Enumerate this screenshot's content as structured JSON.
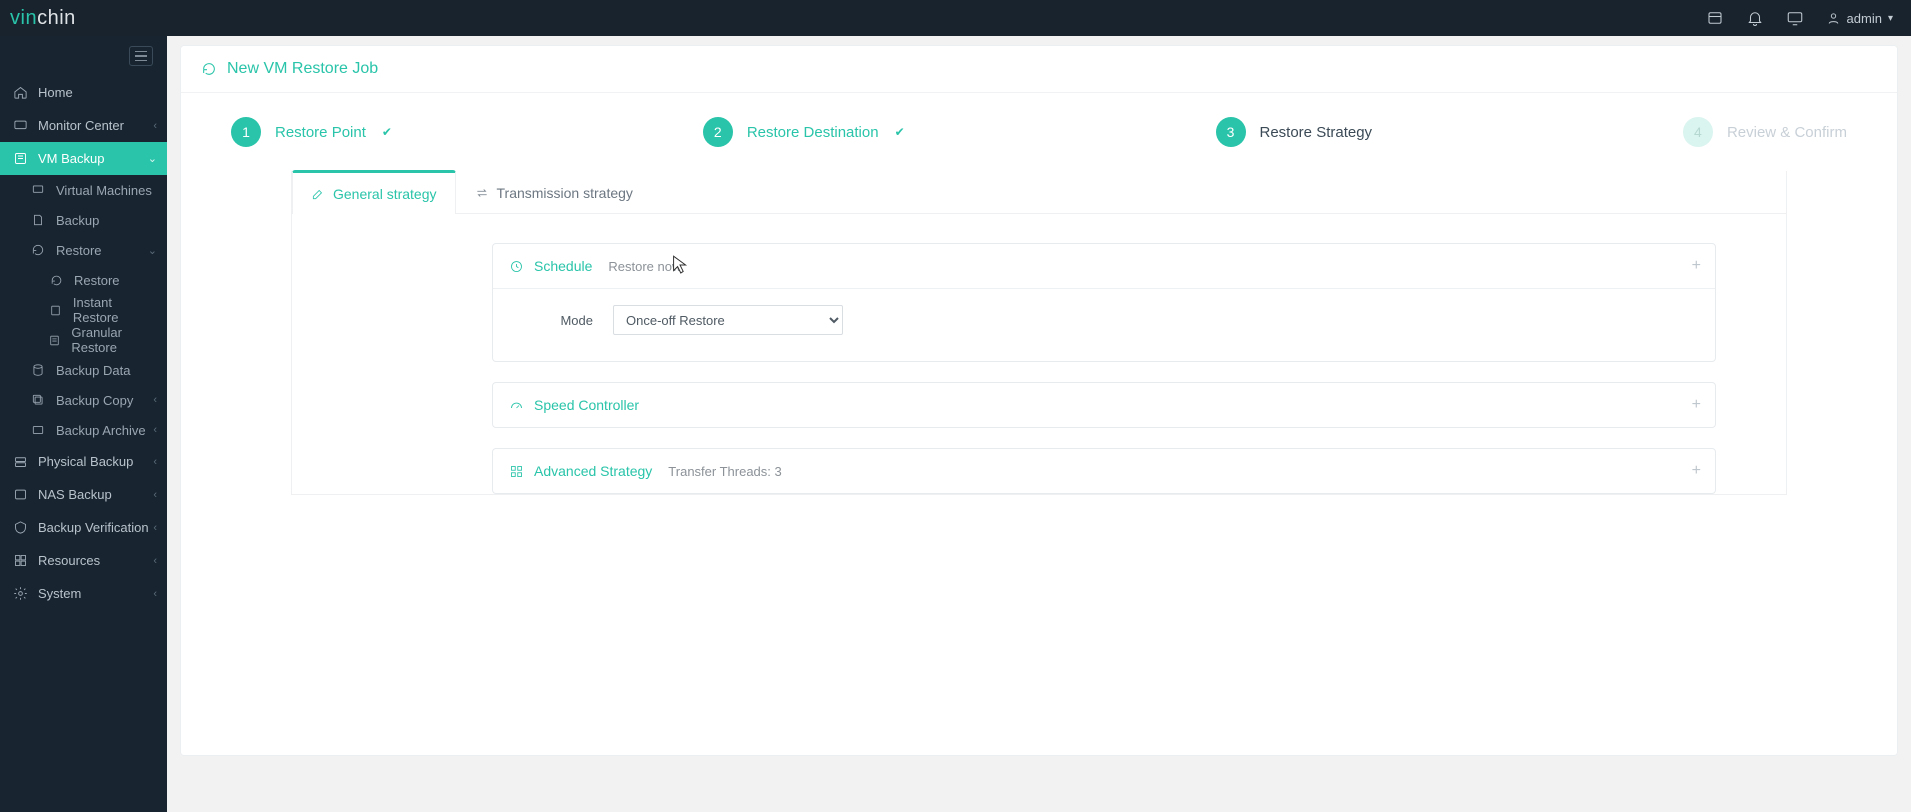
{
  "brand": {
    "part1": "vin",
    "part2": "chin"
  },
  "header": {
    "user_label": "admin"
  },
  "sidebar": {
    "items": [
      {
        "label": "Home"
      },
      {
        "label": "Monitor Center"
      },
      {
        "label": "VM Backup"
      },
      {
        "label": "Virtual Machines"
      },
      {
        "label": "Backup"
      },
      {
        "label": "Restore"
      },
      {
        "label": "Restore"
      },
      {
        "label": "Instant Restore"
      },
      {
        "label": "Granular Restore"
      },
      {
        "label": "Backup Data"
      },
      {
        "label": "Backup Copy"
      },
      {
        "label": "Backup Archive"
      },
      {
        "label": "Physical Backup"
      },
      {
        "label": "NAS Backup"
      },
      {
        "label": "Backup Verification"
      },
      {
        "label": "Resources"
      },
      {
        "label": "System"
      }
    ]
  },
  "page": {
    "title": "New VM Restore Job"
  },
  "wizard": {
    "steps": [
      {
        "num": "1",
        "label": "Restore Point"
      },
      {
        "num": "2",
        "label": "Restore Destination"
      },
      {
        "num": "3",
        "label": "Restore Strategy"
      },
      {
        "num": "4",
        "label": "Review & Confirm"
      }
    ]
  },
  "tabs": {
    "general": "General strategy",
    "transmission": "Transmission strategy"
  },
  "schedule": {
    "title": "Schedule",
    "sub": "Restore now",
    "mode_label": "Mode",
    "mode_value": "Once-off Restore"
  },
  "speed": {
    "title": "Speed Controller"
  },
  "advanced": {
    "title": "Advanced Strategy",
    "sub": "Transfer Threads: 3"
  }
}
